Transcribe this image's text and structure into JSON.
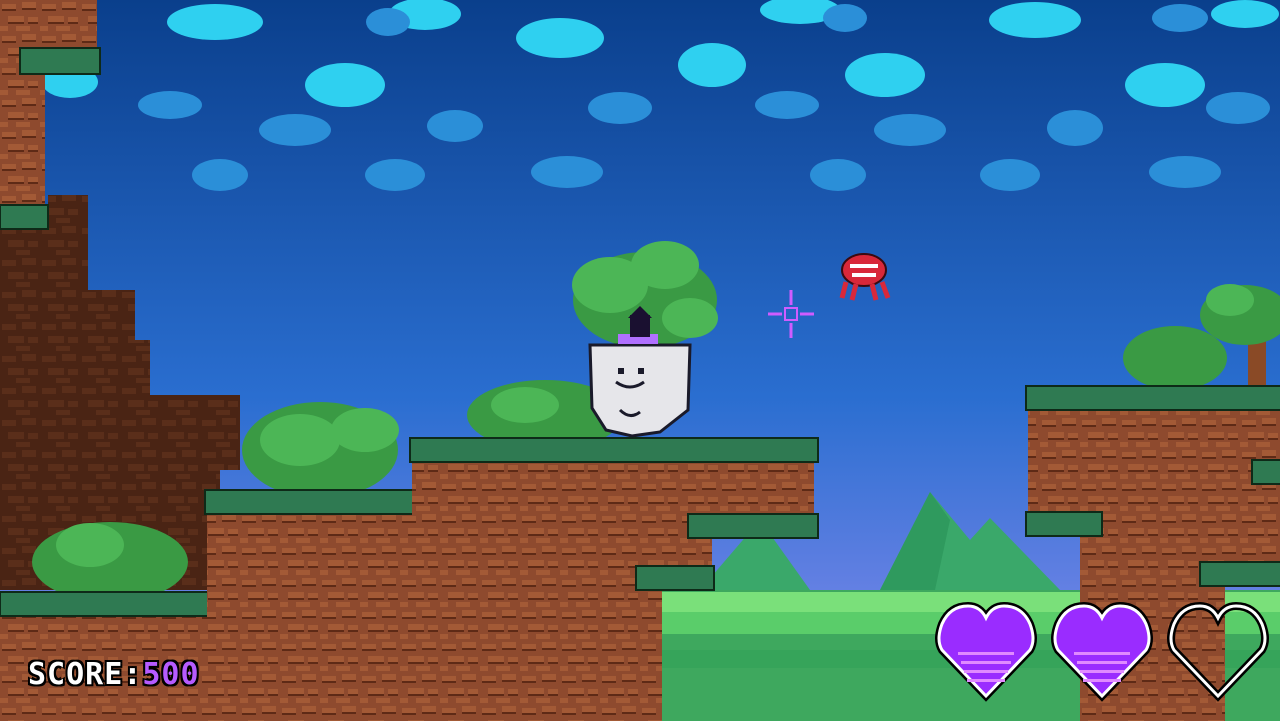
{
  "hud": {
    "score_label": "SCORE",
    "score_separator": ":",
    "score_value": "500"
  },
  "health": {
    "max_hearts": 3,
    "current_hearts": 2,
    "filled_color": "#9a2cff",
    "empty_color": "#ffffff"
  },
  "colors": {
    "sky_top": "#0a3f8c",
    "sky_bottom": "#7a8ef0",
    "dirt": "#8e4a2e",
    "dirt_dark": "#5e2a16",
    "grass": "#2f7a52",
    "bush": "#3a9a44",
    "cloud": "#2fd0f0",
    "enemy": "#d8283a",
    "crosshair": "#d05cff"
  },
  "sprites": {
    "player": "ghost-block-player",
    "enemy": "red-flying-enemy",
    "reticle": "aim-crosshair-icon"
  }
}
